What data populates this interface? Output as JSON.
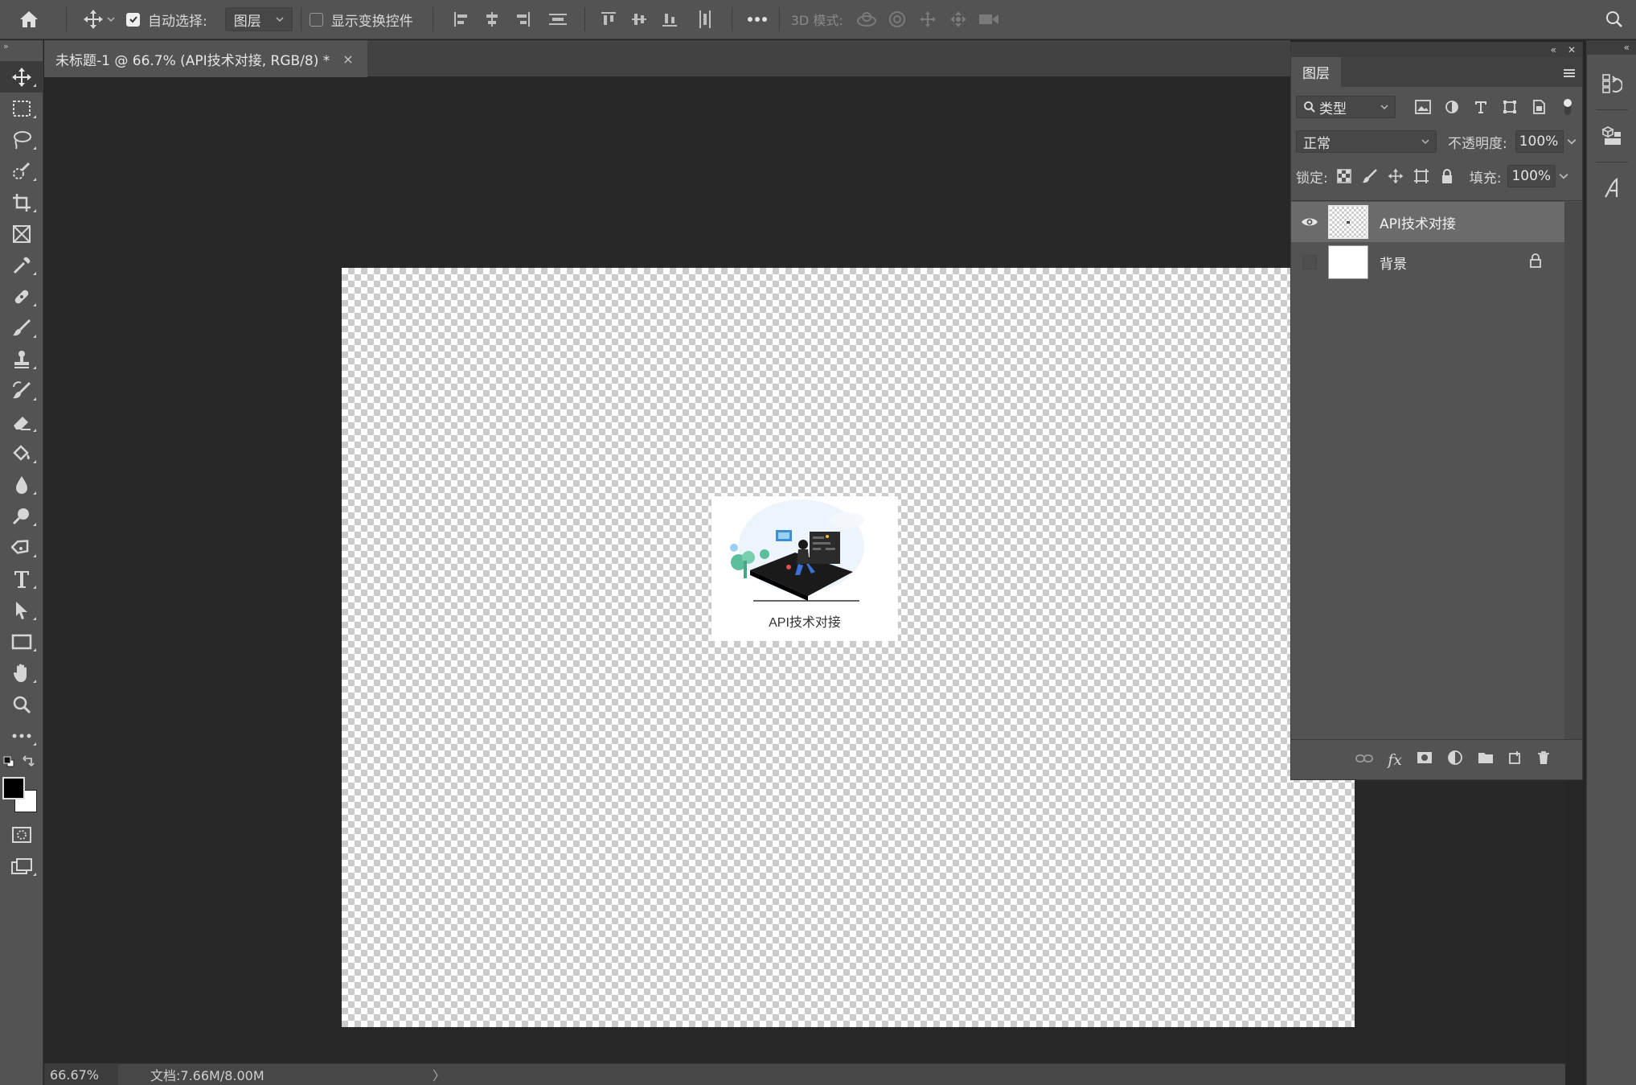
{
  "options_bar": {
    "auto_select_label": "自动选择:",
    "auto_select_checked": true,
    "auto_select_target": "图层",
    "show_transform_label": "显示变换控件",
    "show_transform_checked": false,
    "mode_3d_label": "3D 模式:"
  },
  "document": {
    "tab_title": "未标题-1 @ 66.7% (API技术对接, RGB/8) *",
    "close_glyph": "×",
    "card_caption": "API技术对接"
  },
  "status_bar": {
    "zoom": "66.67%",
    "doc_size": "文档:7.66M/8.00M",
    "arrow": "〉"
  },
  "layers_panel": {
    "title": "图层",
    "filter_kind": "类型",
    "blend_mode": "正常",
    "opacity_label": "不透明度:",
    "opacity_value": "100%",
    "lock_label": "锁定:",
    "fill_label": "填充:",
    "fill_value": "100%",
    "layers": [
      {
        "name": "API技术对接",
        "visible": true,
        "selected": true,
        "locked": false
      },
      {
        "name": "背景",
        "visible": false,
        "selected": false,
        "locked": true
      }
    ]
  },
  "colors": {
    "foreground": "#000000",
    "background": "#ffffff",
    "ui_panel": "#535353",
    "workspace": "#282828"
  }
}
